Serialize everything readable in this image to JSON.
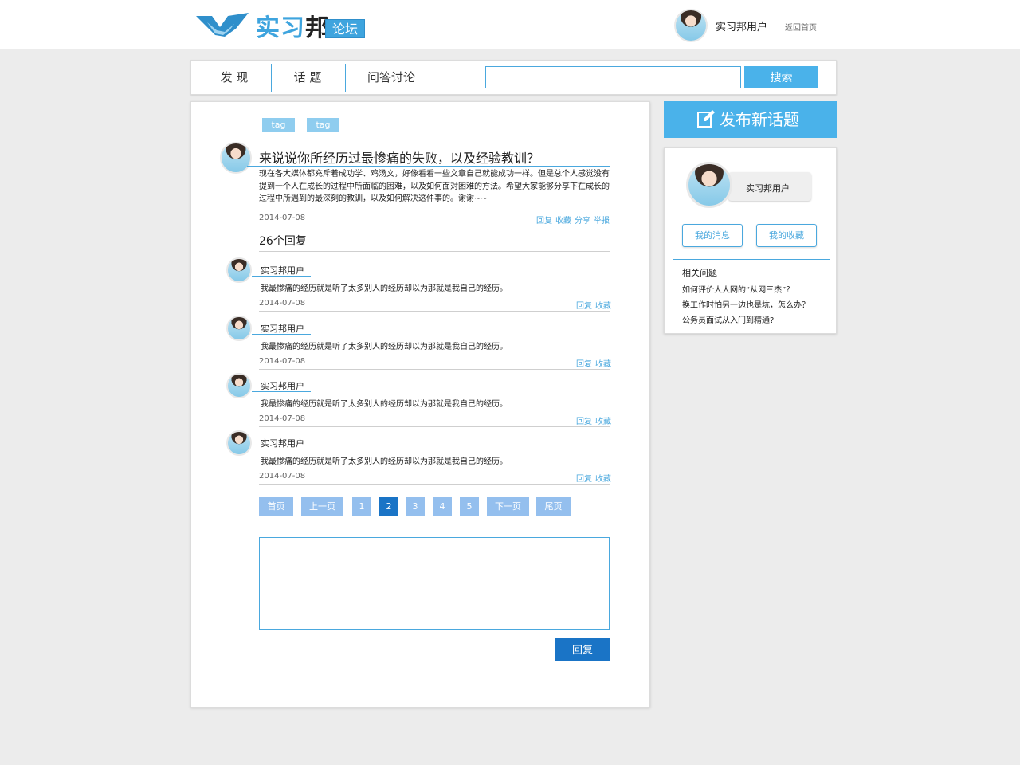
{
  "header": {
    "logo_char1": "实",
    "logo_char2": "习",
    "logo_char3": "邦",
    "forum_label": "论坛",
    "username": "实习邦用户",
    "home_link": "返回首页"
  },
  "nav": {
    "items": [
      "发 现",
      "话 题",
      "问答讨论"
    ],
    "search_placeholder": "",
    "search_button": "搜索"
  },
  "post": {
    "tags": [
      "tag",
      "tag"
    ],
    "title": "来说说你所经历过最惨痛的失败，以及经验教训？",
    "body_lines": [
      "现在各大媒体都充斥着成功学、鸡汤文，好像看看一些文章自己就能成功一样。但是总个人感觉没有",
      "提到一个人在成长的过程中所面临的困难，以及如何面对困难的方法。希望大家能够分享下在成长的",
      "过程中所遇到的最深刻的教训，以及如何解决这件事的。谢谢~~"
    ],
    "date": "2014-07-08",
    "actions": [
      "回复",
      "收藏",
      "分享",
      "举报"
    ],
    "reply_count": "26个回复"
  },
  "replies": [
    {
      "name": "实习邦用户",
      "text": "我最惨痛的经历就是听了太多别人的经历却以为那就是我自己的经历。",
      "date": "2014-07-08",
      "actions": [
        "回复",
        "收藏"
      ]
    },
    {
      "name": "实习邦用户",
      "text": "我最惨痛的经历就是听了太多别人的经历却以为那就是我自己的经历。",
      "date": "2014-07-08",
      "actions": [
        "回复",
        "收藏"
      ]
    },
    {
      "name": "实习邦用户",
      "text": "我最惨痛的经历就是听了太多别人的经历却以为那就是我自己的经历。",
      "date": "2014-07-08",
      "actions": [
        "回复",
        "收藏"
      ]
    },
    {
      "name": "实习邦用户",
      "text": "我最惨痛的经历就是听了太多别人的经历却以为那就是我自己的经历。",
      "date": "2014-07-08",
      "actions": [
        "回复",
        "收藏"
      ]
    }
  ],
  "pagination": {
    "first": "首页",
    "prev": "上一页",
    "pages": [
      "1",
      "2",
      "3",
      "4",
      "5"
    ],
    "current": "2",
    "next": "下一页",
    "last": "尾页"
  },
  "reply_form": {
    "button": "回复"
  },
  "sidebar": {
    "new_topic": "发布新话题",
    "username": "实习邦用户",
    "my_messages": "我的消息",
    "my_favorites": "我的收藏",
    "related_title": "相关问题",
    "related": [
      "如何评价人人网的“从网三杰”？",
      "换工作时怕另一边也是坑，怎么办？",
      "公务员面试从入门到精通?"
    ]
  },
  "colors": {
    "accent": "#4ab2ea",
    "accent_dark": "#1a74c6",
    "line": "#4aa8de",
    "tag": "#8fcdef",
    "pager": "#94bfee"
  }
}
